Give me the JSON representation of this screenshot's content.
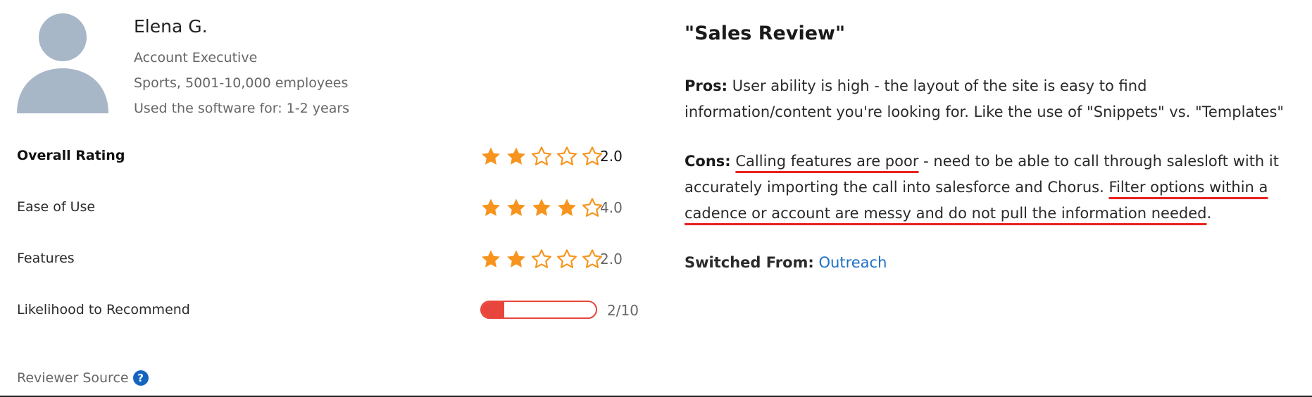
{
  "reviewer": {
    "name": "Elena G.",
    "title": "Account Executive",
    "company": "Sports, 5001-10,000 employees",
    "usage": "Used the software for: 1-2 years"
  },
  "ratings": [
    {
      "label": "Overall Rating",
      "stars": 2,
      "value": "2.0"
    },
    {
      "label": "Ease of Use",
      "stars": 4,
      "value": "4.0"
    },
    {
      "label": "Features",
      "stars": 2,
      "value": "2.0"
    }
  ],
  "recommend": {
    "label": "Likelihood to Recommend",
    "score": 2,
    "max": 10,
    "value": "2/10"
  },
  "reviewer_source": "Reviewer Source",
  "review": {
    "title": "\"Sales Review\"",
    "pros_label": "Pros:",
    "pros_text": "User ability is high - the layout of the site is easy to find information/content you're looking for. Like the use of \"Snippets\" vs. \"Templates\"",
    "cons_label": "Cons:",
    "cons_part1": "Calling features are poor",
    "cons_part2": " - need to be able to call through salesloft with it accurately importing the call into salesforce and Chorus. ",
    "cons_part3": "Filter options within a cadence or account are messy and do not pull the information needed",
    "cons_part4": ".",
    "switched_label": "Switched From:",
    "switched_value": "Outreach"
  },
  "colors": {
    "star_filled": "#f7941d",
    "star_empty": "#f7941d",
    "recommend_bar": "#e8453c",
    "avatar": "#a7b7c8",
    "link": "#1f6fc5",
    "annotation_underline": "#e8211f"
  },
  "icons": {
    "star_filled": "star-filled-icon",
    "star_empty": "star-outline-icon",
    "help": "question-circle-icon",
    "avatar": "user-avatar-icon"
  }
}
